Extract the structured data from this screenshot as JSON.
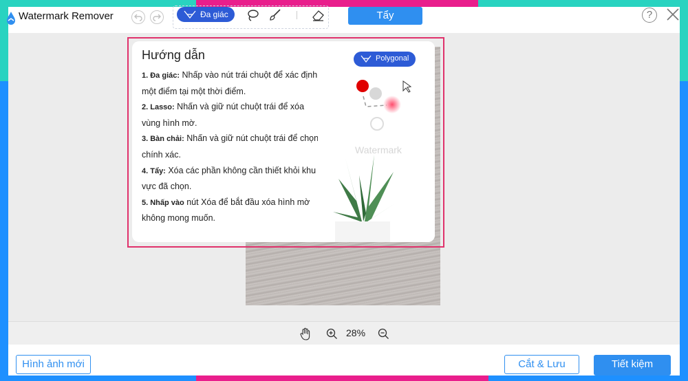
{
  "app": {
    "title": "Watermark Remover"
  },
  "toolbar": {
    "polygon_label": "Đa giác",
    "erase_label": "Tẩy",
    "help_label": "?"
  },
  "guide": {
    "title": "Hướng dẫn",
    "steps": [
      {
        "bold": "1. Đa giác:",
        "text": " Nhấp vào nút trái chuột để xác định một điểm tại một thời điểm."
      },
      {
        "bold": "2. Lasso:",
        "text": " Nhấn và giữ nút chuột trái để xóa vùng hình mờ."
      },
      {
        "bold": "3. Bàn chải:",
        "text": " Nhấn và giữ nút chuột trái để chọn chính xác."
      },
      {
        "bold": "4. Tẩy:",
        "text": " Xóa các phần không cần thiết khỏi khu vực đã chọn."
      },
      {
        "bold": "5. Nhấp vào",
        "text": " nút Xóa để bắt đầu xóa hình mờ không mong muốn."
      }
    ],
    "image_button_label": "Polygonal",
    "watermark_text": "Watermark"
  },
  "zoom": {
    "level": "28%"
  },
  "footer": {
    "new_image_label": "Hình ảnh mới",
    "crop_save_label": "Cắt & Lưu",
    "save_label": "Tiết kiệm"
  },
  "colors": {
    "accent": "#2f8ff0",
    "tool_active": "#2d5bd6",
    "guide_border": "#e0316b",
    "frame_teal": "#29d3c0",
    "frame_pink": "#e91e8c",
    "frame_blue": "#1e90ff"
  }
}
